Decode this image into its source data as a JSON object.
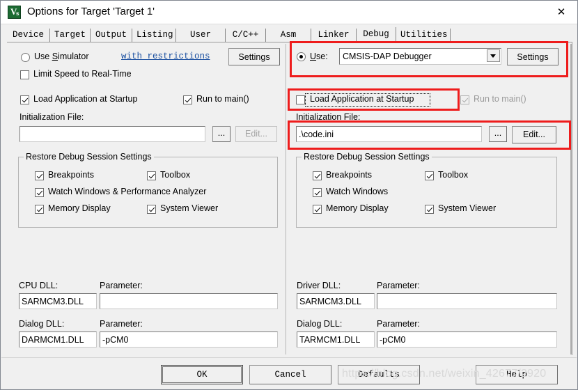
{
  "window": {
    "title": "Options for Target 'Target 1'",
    "icon": "uvision-logo-icon",
    "close_label": "✕"
  },
  "tabs": [
    {
      "label": "Device",
      "active": false
    },
    {
      "label": "Target",
      "active": false
    },
    {
      "label": "Output",
      "active": false
    },
    {
      "label": "Listing",
      "active": false
    },
    {
      "label": "User",
      "active": false
    },
    {
      "label": "C/C++",
      "active": false
    },
    {
      "label": "Asm",
      "active": false
    },
    {
      "label": "Linker",
      "active": false
    },
    {
      "label": "Debug",
      "active": true
    },
    {
      "label": "Utilities",
      "active": false
    }
  ],
  "left_panel": {
    "use_simulator_label": "Use Simulator",
    "use_simulator_mnemonic": "S",
    "use_simulator_checked": false,
    "restrictions_link": "with restrictions",
    "settings_button": "Settings",
    "limit_speed_label": "Limit Speed to Real-Time",
    "limit_speed_checked": false,
    "load_app_label": "Load Application at Startup",
    "load_app_checked": true,
    "run_to_main_label": "Run to main()",
    "run_to_main_checked": true,
    "init_file_label": "Initialization File:",
    "init_file_value": "",
    "browse_button": "...",
    "edit_button": "Edit...",
    "edit_button_enabled": false,
    "restore_group_title": "Restore Debug Session Settings",
    "restore_items": [
      {
        "label": "Breakpoints",
        "checked": true
      },
      {
        "label": "Toolbox",
        "checked": true
      },
      {
        "label": "Watch Windows & Performance Analyzer",
        "checked": true
      },
      {
        "label": "Memory Display",
        "checked": true
      },
      {
        "label": "System Viewer",
        "checked": true
      }
    ],
    "cpu_dll_label": "CPU DLL:",
    "cpu_dll_value": "SARMCM3.DLL",
    "cpu_param_label": "Parameter:",
    "cpu_param_value": "",
    "dialog_dll_label": "Dialog DLL:",
    "dialog_dll_value": "DARMCM1.DLL",
    "dialog_param_label": "Parameter:",
    "dialog_param_value": "-pCM0"
  },
  "right_panel": {
    "use_label": "Use:",
    "use_mnemonic": "U",
    "use_checked": true,
    "debugger_value": "CMSIS-DAP Debugger",
    "settings_button": "Settings",
    "load_app_label": "Load Application at Startup",
    "load_app_checked": false,
    "run_to_main_label": "Run to main()",
    "run_to_main_checked": true,
    "run_to_main_enabled": false,
    "init_file_label": "Initialization File:",
    "init_file_value": ".\\code.ini",
    "browse_button": "...",
    "edit_button": "Edit...",
    "edit_button_enabled": true,
    "restore_group_title": "Restore Debug Session Settings",
    "restore_items": [
      {
        "label": "Breakpoints",
        "checked": true
      },
      {
        "label": "Toolbox",
        "checked": true
      },
      {
        "label": "Watch Windows",
        "checked": true
      },
      {
        "label": "Memory Display",
        "checked": true
      },
      {
        "label": "System Viewer",
        "checked": true
      }
    ],
    "driver_dll_label": "Driver DLL:",
    "driver_dll_value": "SARMCM3.DLL",
    "driver_param_label": "Parameter:",
    "driver_param_value": "",
    "dialog_dll_label": "Dialog DLL:",
    "dialog_dll_value": "TARMCM1.DLL",
    "dialog_param_label": "Parameter:",
    "dialog_param_value": "-pCM0"
  },
  "footer": {
    "ok": "OK",
    "cancel": "Cancel",
    "defaults": "Defaults",
    "help": "Help"
  },
  "watermark": "https://blog.csdn.net/weixin_42677/2920",
  "annotations": {
    "highlight_color": "#ee1c1c",
    "boxes": [
      {
        "name": "debugger-selection-highlight"
      },
      {
        "name": "load-application-highlight"
      },
      {
        "name": "initialization-file-highlight"
      }
    ]
  }
}
